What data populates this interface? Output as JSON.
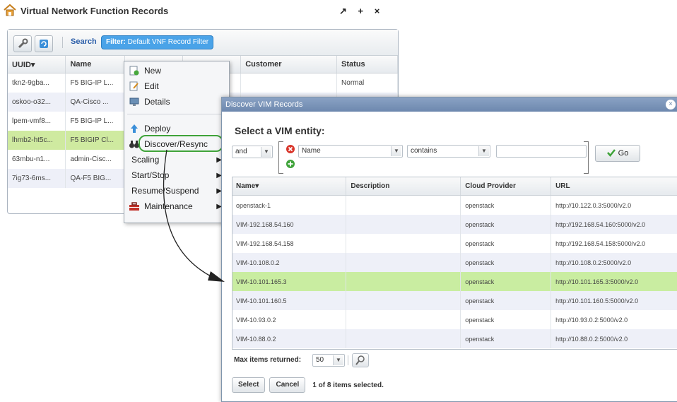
{
  "header": {
    "title": "Virtual Network Function Records",
    "actions": "↗ + ×"
  },
  "toolbar": {
    "search_label": "Search",
    "filter_prefix": "Filter:",
    "filter_value": "Default VNF Record Filter"
  },
  "records_table": {
    "columns": [
      "UUID▾",
      "Name",
      "",
      "",
      "Customer",
      "Status"
    ],
    "rows": [
      [
        "tkn2-9gba...",
        "F5 BIG-IP L...",
        "",
        "",
        "",
        "Normal"
      ],
      [
        "oskoo-o32...",
        "QA-Cisco ...",
        "",
        "",
        "",
        ""
      ],
      [
        "lpem-vmf8...",
        "F5 BIG-IP L...",
        "",
        "",
        "",
        ""
      ],
      [
        "lhmb2-ht5c...",
        "F5 BIGIP Cl...",
        "",
        "",
        "",
        ""
      ],
      [
        "63mbu-n1...",
        "admin-Cisc...",
        "",
        "",
        "",
        ""
      ],
      [
        "7ig73-6ms...",
        "QA-F5 BIG...",
        "",
        "",
        "",
        ""
      ]
    ]
  },
  "context_menu": {
    "items": [
      {
        "label": "New",
        "icon": "new-doc-icon"
      },
      {
        "label": "Edit",
        "icon": "edit-doc-icon"
      },
      {
        "label": "Details",
        "icon": "details-icon"
      },
      {
        "label": "Deploy",
        "icon": "deploy-icon"
      },
      {
        "label": "Discover/Resync",
        "icon": "binoculars-icon"
      },
      {
        "label": "Scaling",
        "icon": ""
      },
      {
        "label": "Start/Stop",
        "icon": ""
      },
      {
        "label": "Resume/Suspend",
        "icon": ""
      },
      {
        "label": "Maintenance",
        "icon": "toolbox-icon"
      }
    ]
  },
  "dialog": {
    "title": "Discover VIM Records",
    "heading": "Select a VIM entity:",
    "logic_select": "and",
    "field_select": "Name",
    "operator_select": "contains",
    "value_input": "",
    "go_label": "Go",
    "columns": [
      "Name▾",
      "Description",
      "Cloud Provider",
      "URL"
    ],
    "rows": [
      [
        "openstack-1",
        "",
        "openstack",
        "http://10.122.0.3:5000/v2.0"
      ],
      [
        "VIM-192.168.54.160",
        "",
        "openstack",
        "http://192.168.54.160:5000/v2.0"
      ],
      [
        "VIM-192.168.54.158",
        "",
        "openstack",
        "http://192.168.54.158:5000/v2.0"
      ],
      [
        "VIM-10.108.0.2",
        "",
        "openstack",
        "http://10.108.0.2:5000/v2.0"
      ],
      [
        "VIM-10.101.165.3",
        "",
        "openstack",
        "http://10.101.165.3:5000/v2.0"
      ],
      [
        "VIM-10.101.160.5",
        "",
        "openstack",
        "http://10.101.160.5:5000/v2.0"
      ],
      [
        "VIM-10.93.0.2",
        "",
        "openstack",
        "http://10.93.0.2:5000/v2.0"
      ],
      [
        "VIM-10.88.0.2",
        "",
        "openstack",
        "http://10.88.0.2:5000/v2.0"
      ]
    ],
    "max_items_label": "Max items returned:",
    "max_items_value": "50",
    "select_label": "Select",
    "cancel_label": "Cancel",
    "selection_status": "1 of 8 items selected."
  },
  "colors": {
    "highlight_row": "#c9eda1",
    "filter_badge": "#4aa3e8",
    "title_bar": "#7a93b8",
    "callout_outline": "#3fa33a"
  }
}
